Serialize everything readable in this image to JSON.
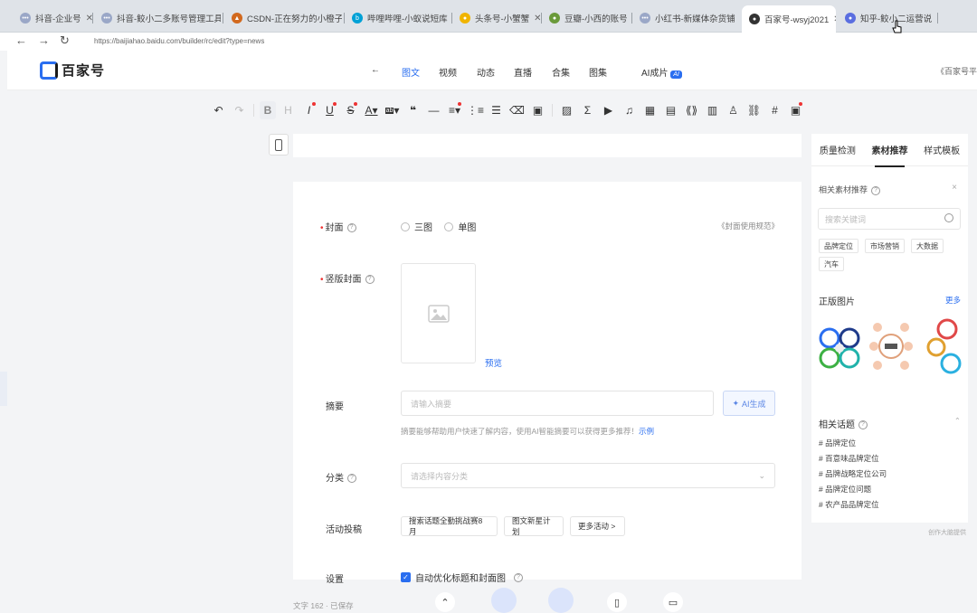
{
  "tabs": [
    {
      "label": "抖音-企业号",
      "fav": "#9aa7c7",
      "favtxt": "•••"
    },
    {
      "label": "抖音-鲛小二多账号管理工具",
      "fav": "#9aa7c7",
      "favtxt": "•••"
    },
    {
      "label": "CSDN-正在努力的小橙子",
      "fav": "#d2691e",
      "favtxt": "▲"
    },
    {
      "label": "哔哩哔哩-小蚁说短库",
      "fav": "#00a1d6",
      "favtxt": "b"
    },
    {
      "label": "头条号-小蟹蟹",
      "fav": "#f0b400",
      "favtxt": "●"
    },
    {
      "label": "豆瓣-小西的账号",
      "fav": "#6a9a3a",
      "favtxt": "●"
    },
    {
      "label": "小红书-新媒体杂货铺",
      "fav": "#9aa7c7",
      "favtxt": "•••"
    },
    {
      "label": "百家号-wsyj2021",
      "fav": "#333333",
      "favtxt": "●"
    },
    {
      "label": "知乎-鲛小二运营说",
      "fav": "#5a6ee0",
      "favtxt": "●"
    }
  ],
  "url": "https://baijiahao.baidu.com/builder/rc/edit?type=news",
  "header": {
    "logo": "百家号",
    "back": "←",
    "nav": [
      "图文",
      "视频",
      "动态",
      "直播",
      "合集",
      "图集",
      "AI成片"
    ],
    "ai_badge": "AI",
    "right": "《百家号平"
  },
  "form": {
    "cover_label": "封面",
    "cover_options": [
      "三图",
      "单图"
    ],
    "cover_link": "《封面使用规范》",
    "vcover_label": "竖版封面",
    "preview": "预览",
    "summary_label": "摘要",
    "summary_placeholder": "请输入摘要",
    "ai_btn": "AI生成",
    "hint": "摘要能够帮助用户快速了解内容，使用AI智能摘要可以获得更多推荐！",
    "hint_link": "示例",
    "category_label": "分类",
    "category_placeholder": "请选择内容分类",
    "activity_label": "活动投稿",
    "activities": [
      "搜索话题全勤挑战赛8月",
      "图文新星计划",
      "更多活动 >"
    ],
    "settings_label": "设置",
    "auto_opt": "自动优化标题和封面图"
  },
  "side": {
    "tabs": [
      "质量检测",
      "素材推荐",
      "样式模板"
    ],
    "related_sub": "相关素材推荐",
    "search_placeholder": "搜索关键词",
    "tags": [
      "品牌定位",
      "市场营销",
      "大数据",
      "汽车"
    ],
    "images_title": "正版图片",
    "more": "更多",
    "topics_title": "相关话题",
    "topics": [
      "# 品牌定位",
      "# 百意味品牌定位",
      "# 品牌战略定位公司",
      "# 品牌定位问题",
      "# 农产品品牌定位"
    ],
    "credit": "创作大脑提供"
  },
  "bottom": {
    "count": "文字 162 · 已保存"
  },
  "colors": {
    "accent": "#2a6ef0",
    "required": "#e33333"
  }
}
